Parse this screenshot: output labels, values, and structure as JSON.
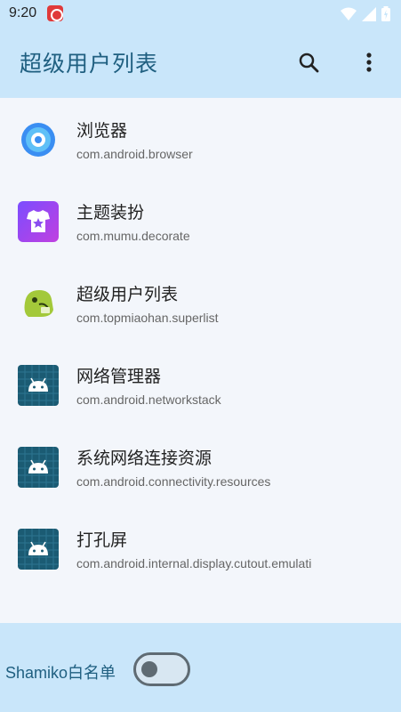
{
  "status_bar": {
    "time": "9:20"
  },
  "app_bar": {
    "title": "超级用户列表"
  },
  "apps": [
    {
      "name": "浏览器",
      "package": "com.android.browser",
      "icon": "browser-icon"
    },
    {
      "name": "主题装扮",
      "package": "com.mumu.decorate",
      "icon": "theme-icon"
    },
    {
      "name": "超级用户列表",
      "package": "com.topmiaohan.superlist",
      "icon": "superlist-app-icon"
    },
    {
      "name": "网络管理器",
      "package": "com.android.networkstack",
      "icon": "android-icon"
    },
    {
      "name": "系统网络连接资源",
      "package": "com.android.connectivity.resources",
      "icon": "android-icon"
    },
    {
      "name": "打孔屏",
      "package": "com.android.internal.display.cutout.emulati",
      "icon": "android-icon"
    }
  ],
  "bottom": {
    "whitelist_label": "Shamiko白名单",
    "toggle_on": false
  },
  "colors": {
    "accent": "#1f5f80",
    "header_bg": "#c9e6fa",
    "list_bg": "#f3f6fb"
  }
}
